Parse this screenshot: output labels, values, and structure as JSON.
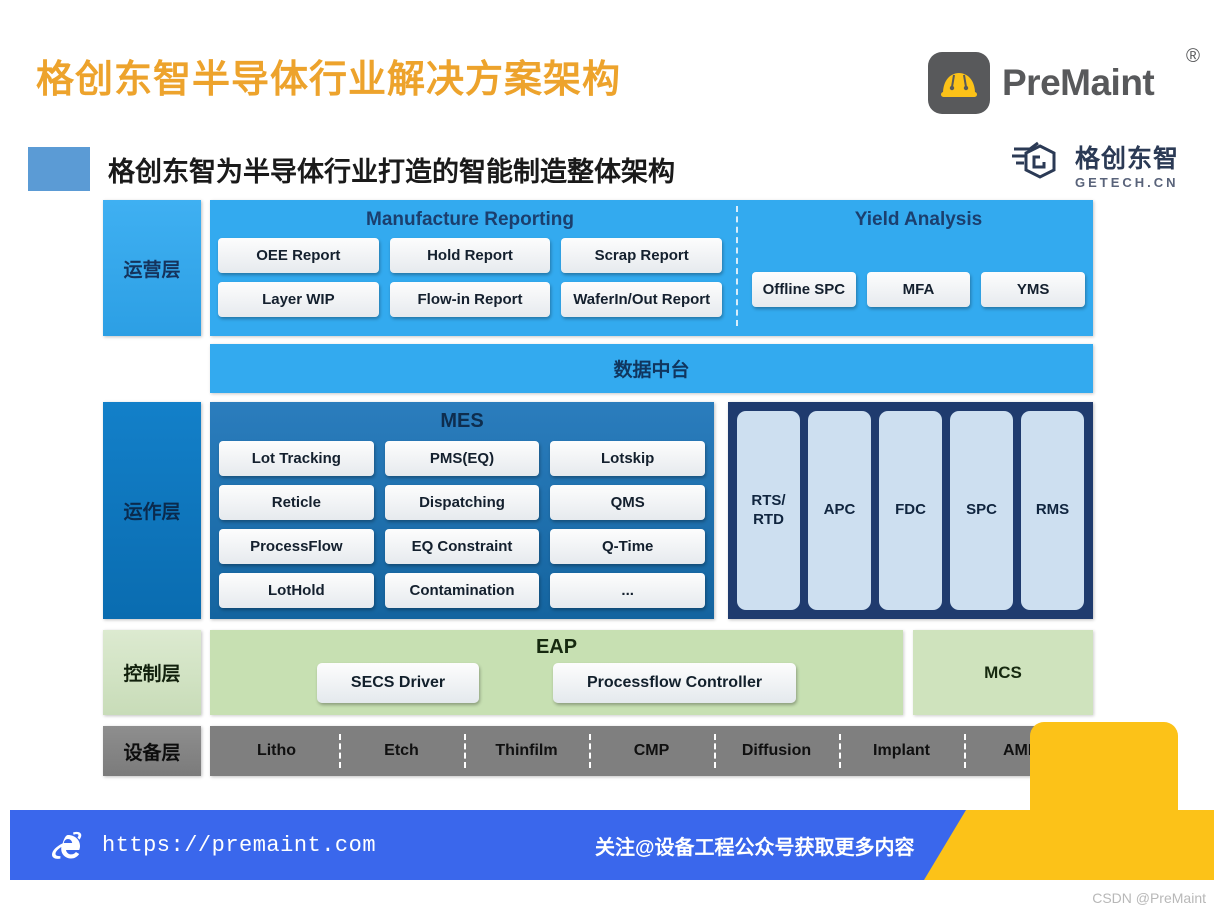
{
  "header": {
    "title": "格创东智半导体行业解决方案架构",
    "premaint_brand": "PreMaint",
    "premaint_registered": "®",
    "premaint_icon": "hard-hat-icon",
    "getech_cn": "格创东智",
    "getech_en": "GETECH.CN",
    "getech_icon": "getech-hex-g-icon"
  },
  "subtitle": {
    "text": "格创东智为半导体行业打造的智能制造整体架构",
    "swatch_color": "#5b9bd5"
  },
  "layers": {
    "operation": {
      "label": "运营层",
      "groups": [
        {
          "title": "Manufacture Reporting",
          "rows": [
            [
              "OEE Report",
              "Hold Report",
              "Scrap Report"
            ],
            [
              "Layer WIP",
              "Flow-in Report",
              "WaferIn/Out Report"
            ]
          ]
        },
        {
          "title": "Yield Analysis",
          "rows": [
            [
              "Offline SPC",
              "MFA",
              "YMS"
            ]
          ]
        }
      ],
      "data_bar": "数据中台"
    },
    "operating": {
      "label": "运作层",
      "mes_title": "MES",
      "mes_rows": [
        [
          "Lot Tracking",
          "PMS(EQ)",
          "Lotskip"
        ],
        [
          "Reticle",
          "Dispatching",
          "QMS"
        ],
        [
          "ProcessFlow",
          "EQ Constraint",
          "Q-Time"
        ],
        [
          "LotHold",
          "Contamination",
          "..."
        ]
      ],
      "apc_columns": [
        "RTS/\nRTD",
        "APC",
        "FDC",
        "SPC",
        "RMS"
      ]
    },
    "control": {
      "label": "控制层",
      "eap_title": "EAP",
      "eap_chips": [
        "SECS Driver",
        "Processflow Controller"
      ],
      "mcs": "MCS"
    },
    "equipment": {
      "label": "设备层",
      "items": [
        "Litho",
        "Etch",
        "Thinfilm",
        "CMP",
        "Diffusion",
        "Implant",
        "AMHS"
      ]
    }
  },
  "footer": {
    "url": "https://premaint.com",
    "browser_icon": "internet-explorer-icon",
    "cn_text": "关注@设备工程公众号获取更多内容",
    "bar_color": "#3a67ec",
    "wedge_color": "#fcc218"
  },
  "watermark": "CSDN @PreMaint"
}
